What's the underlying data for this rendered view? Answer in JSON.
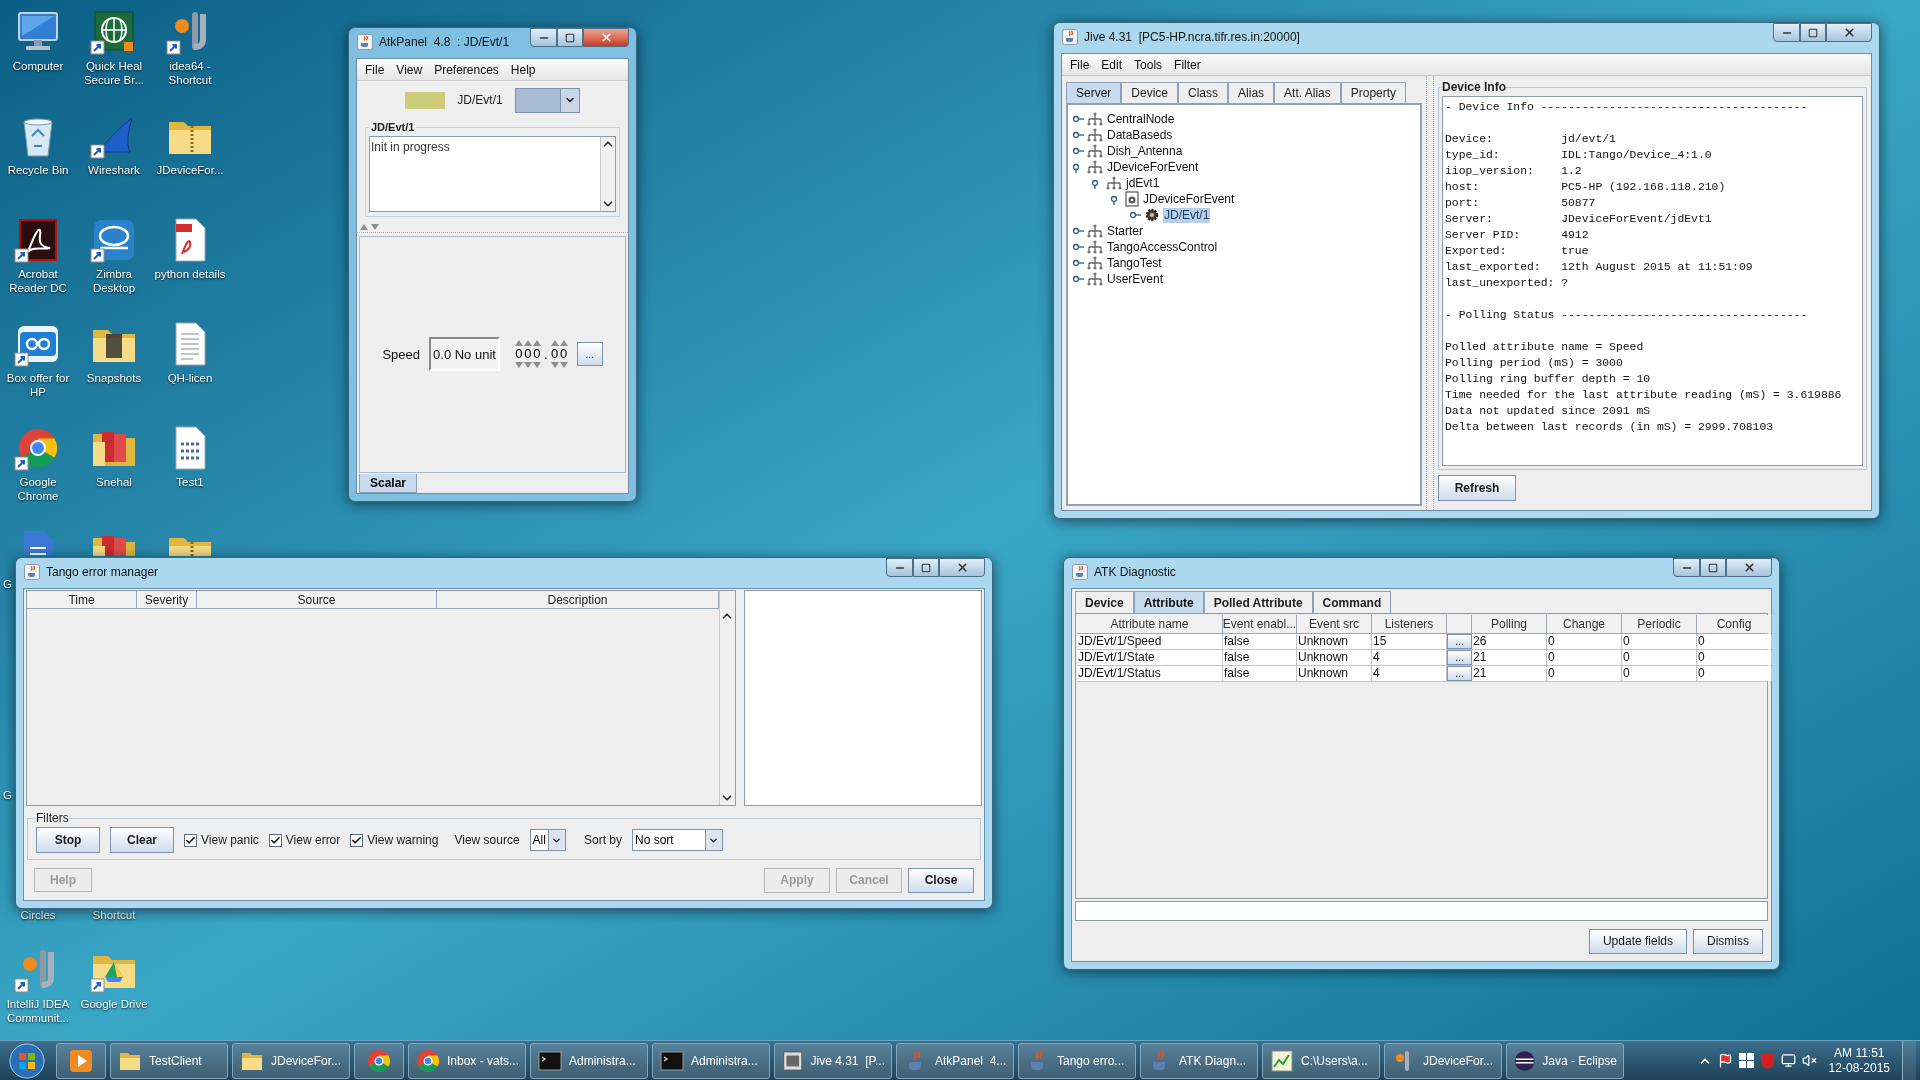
{
  "desktop": {
    "columns": [
      {
        "top": [
          {
            "kind": "computer",
            "label": "Computer",
            "shortcut": false,
            "cut": false
          },
          {
            "kind": "recycle-bin",
            "label": "Recycle Bin",
            "shortcut": false,
            "cut": false
          },
          {
            "kind": "acrobat",
            "label": "Acrobat Reader DC",
            "shortcut": true,
            "cut": false
          },
          {
            "kind": "box",
            "label": "Box offer for HP",
            "shortcut": true,
            "cut": false
          },
          {
            "kind": "chrome",
            "label": "Google Chrome",
            "shortcut": true,
            "cut": false
          },
          {
            "kind": "document",
            "label": "G",
            "shortcut": false,
            "cut": true,
            "partly_hidden": true
          }
        ],
        "bottom": [
          {
            "kind": "covered",
            "label": "G",
            "cut": true
          },
          {
            "kind": "covered-lower",
            "label": "Circles",
            "cut": false
          },
          {
            "kind": "jetbrains",
            "label": "IntelliJ IDEA Communit...",
            "shortcut": true,
            "cut": false
          }
        ]
      },
      {
        "top": [
          {
            "kind": "globe",
            "label": "Quick Heal Secure Br...",
            "shortcut": true,
            "cut": false
          },
          {
            "kind": "fin",
            "label": "Wireshark",
            "shortcut": true,
            "cut": false
          },
          {
            "kind": "zimbra",
            "label": "Zimbra Desktop",
            "shortcut": true,
            "cut": false
          },
          {
            "kind": "folder",
            "label": "Snapshots",
            "shortcut": false,
            "cut": false
          },
          {
            "kind": "folder-red",
            "label": "Snehal",
            "shortcut": false,
            "cut": false
          },
          {
            "kind": "folder-red",
            "shortcut": false,
            "partly_hidden": true
          }
        ],
        "bottom": [
          {
            "kind": "covered-lower",
            "label": "Shortcut",
            "cut": false
          },
          {
            "kind": "drive",
            "label": "Google Drive",
            "shortcut": true,
            "cut": false
          }
        ]
      },
      {
        "top": [
          {
            "kind": "jetbrains",
            "label": "idea64 - Shortcut",
            "shortcut": true,
            "cut": false
          },
          {
            "kind": "zip",
            "label": "JDeviceFor...",
            "shortcut": false,
            "cut": false
          },
          {
            "kind": "pdf",
            "label": "python details",
            "shortcut": false,
            "cut": false
          },
          {
            "kind": "text-file",
            "label": "QH-licen",
            "shortcut": false,
            "cut": false
          },
          {
            "kind": "binary-file",
            "label": "Test1",
            "shortcut": false,
            "cut": false
          },
          {
            "kind": "zip",
            "shortcut": false,
            "partly_hidden": true
          }
        ]
      }
    ]
  },
  "atk_panel": {
    "title": "AtkPanel  4.8  : JD/Evt/1",
    "active": true,
    "menu": [
      "File",
      "View",
      "Preferences",
      "Help"
    ],
    "state_indicator": {
      "color": "#cccc7a"
    },
    "device_label": "JD/Evt/1",
    "status_group": {
      "title": "JD/Evt/1",
      "text": "Init in progress"
    },
    "scalar": {
      "label": "Speed",
      "value": "0.0 No unit",
      "integer_digits": "000",
      "separator": ".",
      "fraction_digits": "00",
      "more": "..."
    },
    "tabs": [
      {
        "label": "Scalar",
        "selected": true
      }
    ]
  },
  "jive": {
    "title": "Jive 4.31  [PC5-HP.ncra.tifr.res.in:20000]",
    "active": false,
    "menu": [
      "File",
      "Edit",
      "Tools",
      "Filter"
    ],
    "tabs": [
      {
        "label": "Server",
        "selected": true
      },
      {
        "label": "Device",
        "selected": false
      },
      {
        "label": "Class",
        "selected": false
      },
      {
        "label": "Alias",
        "selected": false
      },
      {
        "label": "Att. Alias",
        "selected": false
      },
      {
        "label": "Property",
        "selected": false
      }
    ],
    "tree": [
      {
        "label": "CentralNode",
        "kind": "server",
        "expanded": false,
        "selected": false
      },
      {
        "label": "DataBaseds",
        "kind": "server",
        "expanded": false,
        "selected": false
      },
      {
        "label": "Dish_Antenna",
        "kind": "server",
        "expanded": false,
        "selected": false
      },
      {
        "label": "JDeviceForEvent",
        "kind": "server",
        "expanded": true,
        "selected": false,
        "children": [
          {
            "label": "jdEvt1",
            "kind": "server",
            "expanded": true,
            "selected": false,
            "children": [
              {
                "label": "JDeviceForEvent",
                "kind": "class",
                "expanded": true,
                "selected": false,
                "children": [
                  {
                    "label": "JD/Evt/1",
                    "kind": "device",
                    "expanded": false,
                    "selected": true
                  }
                ]
              }
            ]
          }
        ]
      },
      {
        "label": "Starter",
        "kind": "server",
        "expanded": false,
        "selected": false
      },
      {
        "label": "TangoAccessControl",
        "kind": "server",
        "expanded": false,
        "selected": false
      },
      {
        "label": "TangoTest",
        "kind": "server",
        "expanded": false,
        "selected": false
      },
      {
        "label": "UserEvent",
        "kind": "server",
        "expanded": false,
        "selected": false
      }
    ],
    "device_info": {
      "title": "Device Info",
      "blocks": [
        [
          "- Device Info ---------------------------------------"
        ],
        [
          "Device:          jd/evt/1",
          "type_id:         IDL:Tango/Device_4:1.0",
          "iiop_version:    1.2",
          "host:            PC5-HP (192.168.118.210)",
          "port:            50877",
          "Server:          JDeviceForEvent/jdEvt1",
          "Server PID:      4912",
          "Exported:        true",
          "last_exported:   12th August 2015 at 11:51:09",
          "last_unexported: ?"
        ],
        [
          "- Polling Status ------------------------------------"
        ],
        [
          "Polled attribute name = Speed",
          "Polling period (mS) = 3000",
          "Polling ring buffer depth = 10",
          "Time needed for the last attribute reading (mS) = 3.619886",
          "Data not updated since 2091 mS",
          "Delta between last records (in mS) = 2999.708103"
        ]
      ]
    },
    "refresh": "Refresh"
  },
  "error_manager": {
    "title": "Tango error manager",
    "active": false,
    "columns": [
      "Time",
      "Severity",
      "Source",
      "Description"
    ],
    "filters": {
      "title": "Filters",
      "buttons": [
        "Stop",
        "Clear"
      ],
      "checks": [
        {
          "label": "View panic",
          "checked": true
        },
        {
          "label": "View error",
          "checked": true
        },
        {
          "label": "View warning",
          "checked": true
        }
      ],
      "view_source": {
        "label": "View source",
        "value": "All"
      },
      "sort_by": {
        "label": "Sort by",
        "value": "No sort"
      }
    },
    "help": {
      "label": "Help",
      "disabled": true
    },
    "buttons": [
      {
        "label": "Apply",
        "disabled": true
      },
      {
        "label": "Cancel",
        "disabled": true
      },
      {
        "label": "Close",
        "disabled": false
      }
    ]
  },
  "atk_diagnostic": {
    "title": "ATK Diagnostic",
    "active": false,
    "tabs": [
      {
        "label": "Device",
        "selected": false
      },
      {
        "label": "Attribute",
        "selected": true
      },
      {
        "label": "Polled Attribute",
        "selected": false
      },
      {
        "label": "Command",
        "selected": false
      }
    ],
    "table": {
      "columns": [
        {
          "kind": "text",
          "label": "Attribute name"
        },
        {
          "kind": "text",
          "label": "Event enabl..."
        },
        {
          "kind": "text",
          "label": "Event src"
        },
        {
          "kind": "text",
          "label": "Listeners"
        },
        {
          "kind": "button"
        },
        {
          "kind": "text",
          "label": "Polling"
        },
        {
          "kind": "text",
          "label": "Change"
        },
        {
          "kind": "text",
          "label": "Periodic"
        },
        {
          "kind": "text",
          "label": "Config"
        }
      ],
      "rows": [
        {
          "cells": [
            "JD/Evt/1/Speed",
            "false",
            "Unknown",
            "15",
            "...",
            "26",
            "0",
            "0",
            "0"
          ]
        },
        {
          "cells": [
            "JD/Evt/1/State",
            "false",
            "Unknown",
            "4",
            "...",
            "21",
            "0",
            "0",
            "0"
          ]
        },
        {
          "cells": [
            "JD/Evt/1/Status",
            "false",
            "Unknown",
            "4",
            "...",
            "21",
            "0",
            "0",
            "0"
          ]
        }
      ]
    },
    "buttons": [
      "Update fields",
      "Dismiss"
    ]
  },
  "taskbar": {
    "items": [
      {
        "kind": "media"
      },
      {
        "kind": "folder",
        "label": "TestClient"
      },
      {
        "kind": "folder",
        "label": "JDeviceFor..."
      },
      {
        "kind": "chrome"
      },
      {
        "kind": "chrome",
        "label": "Inbox - vats..."
      },
      {
        "kind": "console",
        "label": "Administra..."
      },
      {
        "kind": "console",
        "label": "Administra..."
      },
      {
        "kind": "jive",
        "label": "Jive 4.31  [P..."
      },
      {
        "kind": "java",
        "label": "AtkPanel  4..."
      },
      {
        "kind": "java",
        "label": "Tango erro..."
      },
      {
        "kind": "java",
        "label": "ATK Diagn..."
      },
      {
        "kind": "chart",
        "label": "C:\\Users\\a..."
      },
      {
        "kind": "jetbrains",
        "label": "JDeviceFor..."
      },
      {
        "kind": "eclipse",
        "label": "Java - Eclipse"
      }
    ],
    "clock": {
      "time": "AM 11:51",
      "date": "12-08-2015"
    }
  }
}
